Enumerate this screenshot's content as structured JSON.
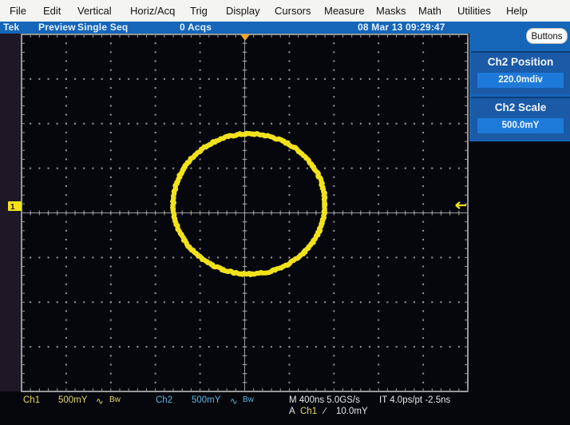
{
  "menu": {
    "items": [
      {
        "label": "File",
        "mnemonic_index": 0
      },
      {
        "label": "Edit",
        "mnemonic_index": 0
      },
      {
        "label": "Vertical",
        "mnemonic_index": 0
      },
      {
        "label": "Horiz/Acq",
        "mnemonic_index": 1
      },
      {
        "label": "Trig",
        "mnemonic_index": 0
      },
      {
        "label": "Display",
        "mnemonic_index": 0
      },
      {
        "label": "Cursors",
        "mnemonic_index": 0
      },
      {
        "label": "Measure",
        "mnemonic_index": 4
      },
      {
        "label": "Masks",
        "mnemonic_index": 1
      },
      {
        "label": "Math",
        "mnemonic_index": 0
      },
      {
        "label": "Utilities",
        "mnemonic_index": 0
      },
      {
        "label": "Help",
        "mnemonic_index": 0
      }
    ]
  },
  "status": {
    "brand": "Tek",
    "mode": "Preview",
    "acq_mode": "Single Seq",
    "acqs": "0 Acqs",
    "datetime": "08 Mar 13 09:29:47"
  },
  "right_panel": {
    "buttons_label": "Buttons",
    "controls": [
      {
        "title": "Ch2 Position",
        "value": "220.0mdiv"
      },
      {
        "title": "Ch2 Scale",
        "value": "500.0mY"
      }
    ]
  },
  "display": {
    "mode": "XY",
    "divisions": {
      "horizontal": 10,
      "vertical": 8
    },
    "trace_color": "#f2e21c",
    "trace": {
      "shape": "circle (Lissajous)",
      "center_div": [
        0.1,
        0.2
      ],
      "radius_div": [
        1.7,
        1.57
      ]
    },
    "ch1_marker": {
      "label": "1",
      "color": "#f2e21c"
    },
    "trigger_level_arrow": {
      "color": "#f2e21c"
    },
    "trigger_position_marker": {
      "color": "#f5a623"
    }
  },
  "readouts": {
    "ch1": {
      "label": "Ch1",
      "scale": "500mY",
      "coupling": "∿",
      "bw": "Bw",
      "color": "#e8d95e"
    },
    "ch2": {
      "label": "Ch2",
      "scale": "500mY",
      "coupling": "∿",
      "bw": "Bw",
      "color": "#5bb7e4"
    },
    "horizontal": "M 400ns 5.0GS/s",
    "interp": "IT 4.0ps/pt -2.5ns",
    "trigger": {
      "prefix": "A",
      "source": "Ch1",
      "slope": "∕",
      "level": "10.0mY"
    }
  }
}
